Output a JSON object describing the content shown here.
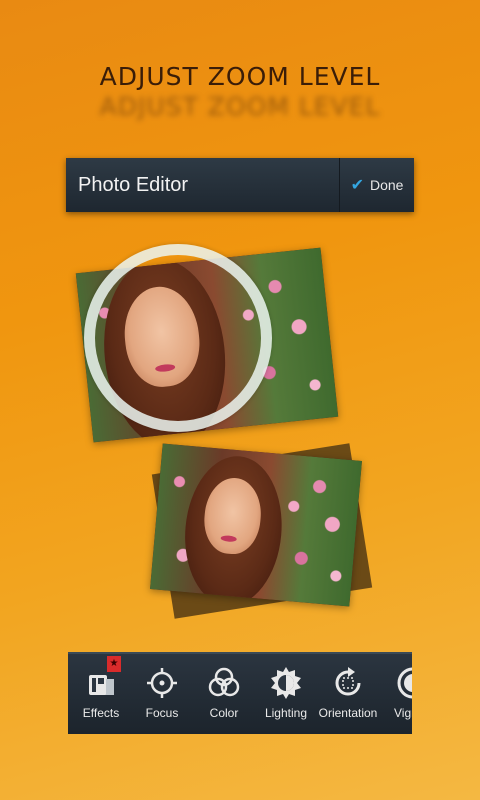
{
  "headline": "ADJUST ZOOM LEVEL",
  "headline_echo": "ADJUST ZOOM LEVEL",
  "editor": {
    "title": "Photo Editor",
    "done_label": "Done"
  },
  "toolbar": {
    "tools": [
      {
        "label": "Effects",
        "icon": "effects-icon"
      },
      {
        "label": "Focus",
        "icon": "focus-icon"
      },
      {
        "label": "Color",
        "icon": "color-icon"
      },
      {
        "label": "Lighting",
        "icon": "lighting-icon"
      },
      {
        "label": "Orientation",
        "icon": "orientation-icon"
      },
      {
        "label": "Vignette",
        "icon": "vignette-icon"
      }
    ]
  },
  "colors": {
    "background": "#f0960f",
    "bar": "#1e2730",
    "accent": "#33a6e0",
    "badge": "#d92b2b"
  }
}
